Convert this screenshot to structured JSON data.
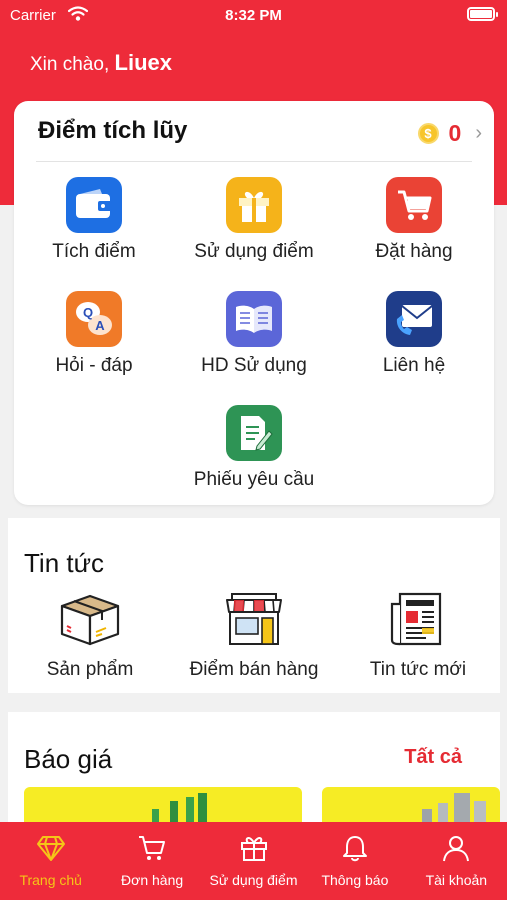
{
  "status": {
    "carrier": "Carrier",
    "time": "8:32 PM"
  },
  "greeting": {
    "prefix": "Xin chào,",
    "name": "Liuex"
  },
  "points": {
    "title": "Điểm tích lũy",
    "coin_symbol": "$",
    "value": "0",
    "items": [
      {
        "label": "Tích điểm",
        "icon": "wallet-icon",
        "color": "#1e6fe3"
      },
      {
        "label": "Sử dụng điểm",
        "icon": "gift-icon",
        "color": "#f5b31a"
      },
      {
        "label": "Đặt hàng",
        "icon": "cart-icon",
        "color": "#ea4335"
      },
      {
        "label": "Hỏi - đáp",
        "icon": "qa-icon",
        "color": "#f07a28",
        "q": "Q",
        "a": "A"
      },
      {
        "label": "HD Sử dụng",
        "icon": "book-icon",
        "color": "#5b66d8"
      },
      {
        "label": "Liên hệ",
        "icon": "envelope-phone-icon",
        "color": "#1f3d8a"
      },
      {
        "label": "Phiếu yêu cầu",
        "icon": "document-edit-icon",
        "color": "#2e9455"
      }
    ]
  },
  "news": {
    "title": "Tin tức",
    "items": [
      {
        "label": "Sản phẩm",
        "icon": "box-icon"
      },
      {
        "label": "Điểm bán hàng",
        "icon": "store-icon"
      },
      {
        "label": "Tin tức mới",
        "icon": "newspaper-icon"
      }
    ]
  },
  "pricing": {
    "title": "Báo giá",
    "see_all": "Tất cả"
  },
  "tabbar": {
    "items": [
      {
        "label": "Trang chủ",
        "icon": "diamond-icon",
        "active": true
      },
      {
        "label": "Đơn hàng",
        "icon": "cart-icon",
        "active": false
      },
      {
        "label": "Sử dụng điểm",
        "icon": "gift-icon",
        "active": false
      },
      {
        "label": "Thông báo",
        "icon": "bell-icon",
        "active": false
      },
      {
        "label": "Tài khoản",
        "icon": "user-icon",
        "active": false
      }
    ]
  },
  "colors": {
    "primary": "#ee2b3a",
    "accent": "#e52b33",
    "active_tab": "#f5c518",
    "banner": "#f6ec25"
  }
}
